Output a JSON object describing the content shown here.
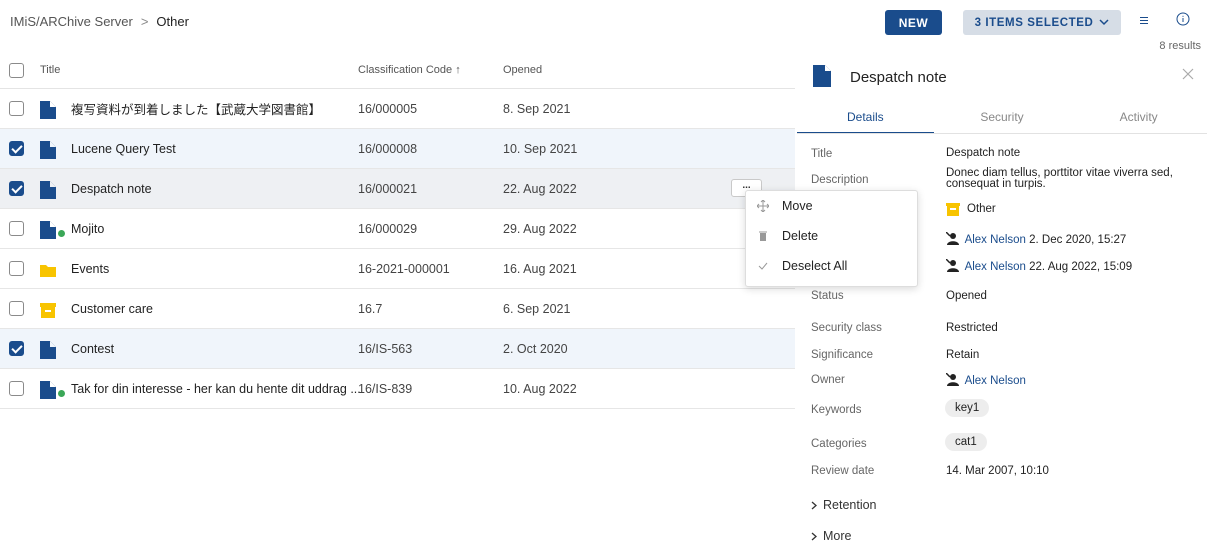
{
  "breadcrumb": {
    "root": "IMiS/ARChive Server",
    "separator": ">",
    "current": "Other"
  },
  "toolbar": {
    "new_label": "NEW",
    "selected_label": "3 ITEMS SELECTED",
    "results": "8 results"
  },
  "colors": {
    "accent": "#1a4c8c",
    "folder": "#f8c400",
    "badge": "#3aa757"
  },
  "table": {
    "headers": {
      "title": "Title",
      "code": "Classification Code ↑",
      "opened": "Opened"
    },
    "rows": [
      {
        "icon": "document-icon",
        "title": "複写資料が到着しました【武蔵大学図書館】",
        "code": "16/000005",
        "opened": "8. Sep 2021",
        "checked": false
      },
      {
        "icon": "document-icon",
        "title": "Lucene Query Test",
        "code": "16/000008",
        "opened": "10. Sep 2021",
        "checked": true
      },
      {
        "icon": "document-icon",
        "title": "Despatch note",
        "code": "16/000021",
        "opened": "22. Aug 2022",
        "checked": true
      },
      {
        "icon": "document-icon",
        "title": "Mojito",
        "code": "16/000029",
        "opened": "29. Aug 2022",
        "checked": false
      },
      {
        "icon": "folder-icon",
        "title": "Events",
        "code": "16-2021-000001",
        "opened": "16. Aug 2021",
        "checked": false
      },
      {
        "icon": "archive-box-icon",
        "title": "Customer care",
        "code": "16.7",
        "opened": "6. Sep 2021",
        "checked": false
      },
      {
        "icon": "document-icon",
        "title": "Contest",
        "code": "16/IS-563",
        "opened": "2. Oct 2020",
        "checked": true
      },
      {
        "icon": "document-icon",
        "title": "Tak for din interesse - her kan du hente dit uddrag ...",
        "code": "16/IS-839",
        "opened": "10. Aug 2022",
        "checked": false
      }
    ],
    "row_menu_label": "..."
  },
  "context_menu": {
    "items": [
      "Move",
      "Delete",
      "Deselect All"
    ]
  },
  "panel": {
    "title": "Despatch note",
    "tabs": [
      "Details",
      "Security",
      "Activity"
    ],
    "props": {
      "title_label": "Title",
      "title_value": "Despatch note",
      "description_label": "Description",
      "description_value": "Donec diam tellus, porttitor vitae viverra sed, consequat in turpis.",
      "location_value": "Other",
      "created_user": "Alex Nelson",
      "created_date": "2. Dec 2020, 15:27",
      "modified_user": "Alex Nelson",
      "modified_date": "22. Aug 2022, 15:09",
      "status_label": "Status",
      "status_value": "Opened",
      "security_label": "Security class",
      "security_value": "Restricted",
      "significance_label": "Significance",
      "significance_value": "Retain",
      "owner_label": "Owner",
      "owner_value": "Alex Nelson",
      "keywords_label": "Keywords",
      "keywords_value": "key1",
      "categories_label": "Categories",
      "categories_value": "cat1",
      "review_label": "Review date",
      "review_value": "14. Mar 2007, 10:10"
    },
    "expanders": [
      "Retention",
      "More"
    ]
  }
}
